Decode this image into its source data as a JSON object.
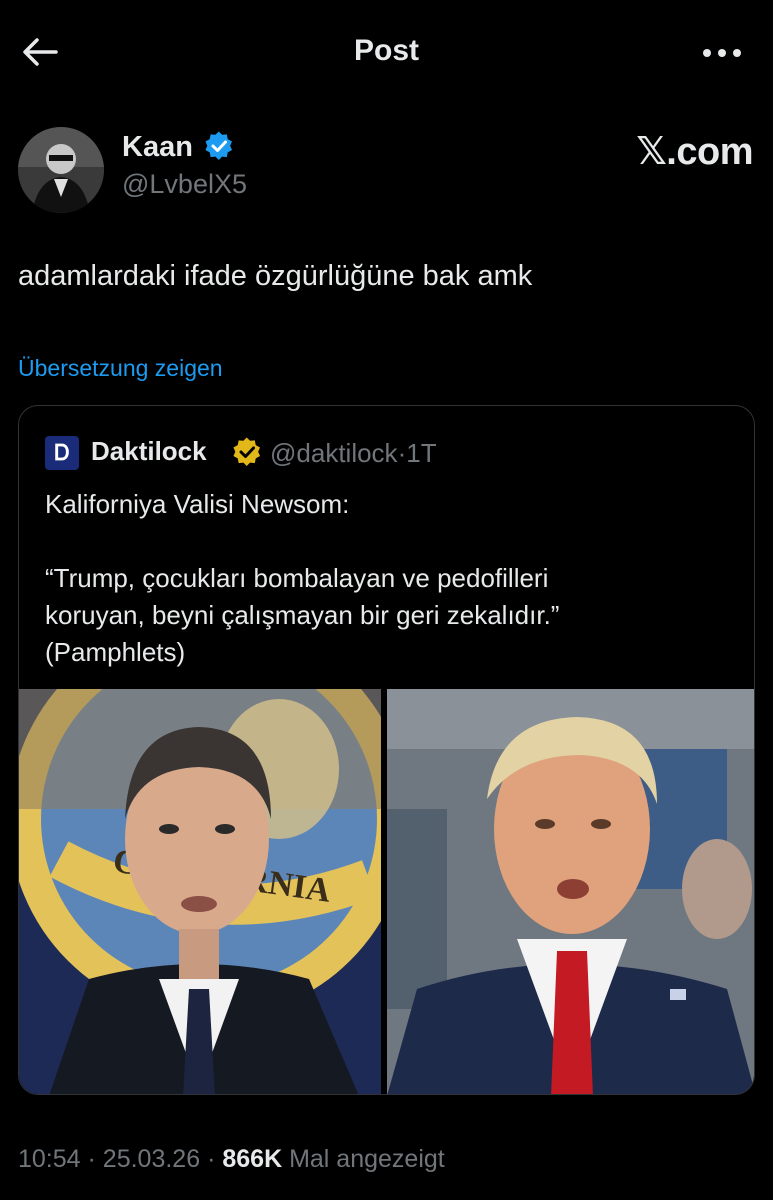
{
  "header": {
    "title": "Post",
    "back_icon": "arrow-left-icon",
    "more_icon": "more-horizontal-icon"
  },
  "author": {
    "name": "Kaan",
    "handle": "@LvbelX5",
    "verified": true,
    "verified_color": "#1d9bf0"
  },
  "brand_watermark": "𝕏.com",
  "post": {
    "text": "adamlardaki ifade özgürlüğüne bak amk",
    "translate_label": "Übersetzung zeigen"
  },
  "quote": {
    "avatar_glyph": "Ꭰ",
    "name": "Daktilock",
    "verified_color": "#e2b719",
    "handle": "@daktilock",
    "separator": "·",
    "age": "1T",
    "lines": [
      "Kaliforniya Valisi Newsom:",
      "",
      "“Trump, çocukları bombalayan ve pedofilleri",
      "koruyan, beyni çalışmayan bir geri zekalıdır.”",
      "(Pamphlets)"
    ],
    "media": {
      "left_seal_text": "CALIFORNIA",
      "right_flag_pin": "us-flag-pin"
    }
  },
  "meta": {
    "time": "10:54",
    "sep1": "·",
    "date": "25.03.26",
    "sep2": "·",
    "views": "866K",
    "views_label": "Mal angezeigt"
  },
  "colors": {
    "background": "#000000",
    "text": "#e7e9ea",
    "muted": "#71767b",
    "link": "#1d9bf0",
    "border": "#2f3336"
  }
}
